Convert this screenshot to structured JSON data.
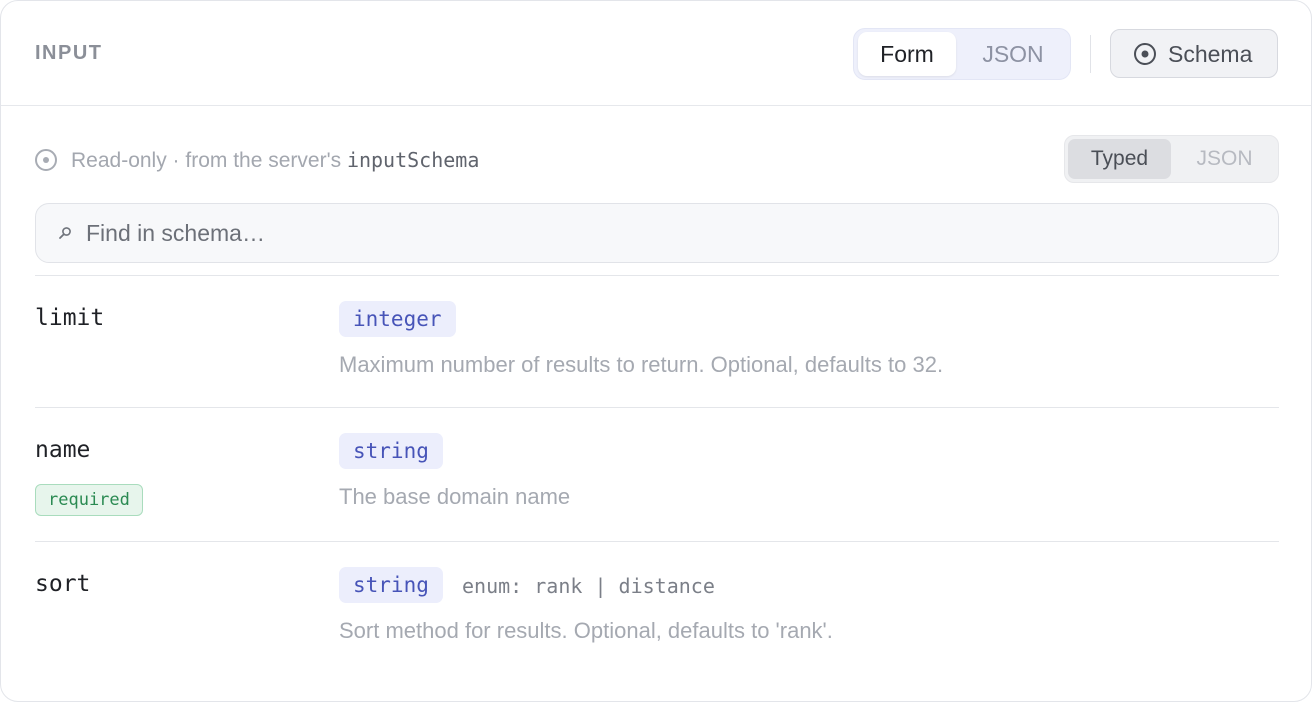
{
  "header": {
    "title": "INPUT",
    "mode_toggle": {
      "options": [
        "Form",
        "JSON"
      ],
      "selected": "Form"
    },
    "schema_button": {
      "label": "Schema",
      "icon": "target-icon"
    }
  },
  "info": {
    "icon": "target-icon",
    "text_prefix": "Read-only · from the server's ",
    "code": "inputSchema"
  },
  "view_toggle": {
    "options": [
      "Typed",
      "JSON"
    ],
    "selected": "Typed"
  },
  "search": {
    "icon": "search-icon",
    "placeholder": "Find in schema…",
    "value": ""
  },
  "fields": [
    {
      "name": "limit",
      "type": "integer",
      "required": false,
      "description": "Maximum number of results to return. Optional, defaults to 32."
    },
    {
      "name": "name",
      "type": "string",
      "required": true,
      "required_label": "required",
      "description": "The base domain name"
    },
    {
      "name": "sort",
      "type": "string",
      "required": false,
      "enum_text": "enum: rank | distance",
      "description": "Sort method for results. Optional, defaults to 'rank'."
    }
  ],
  "colors": {
    "accent_type": "#4754b8",
    "required_green": "#2a8a52",
    "muted_text": "#a5a9b1"
  }
}
